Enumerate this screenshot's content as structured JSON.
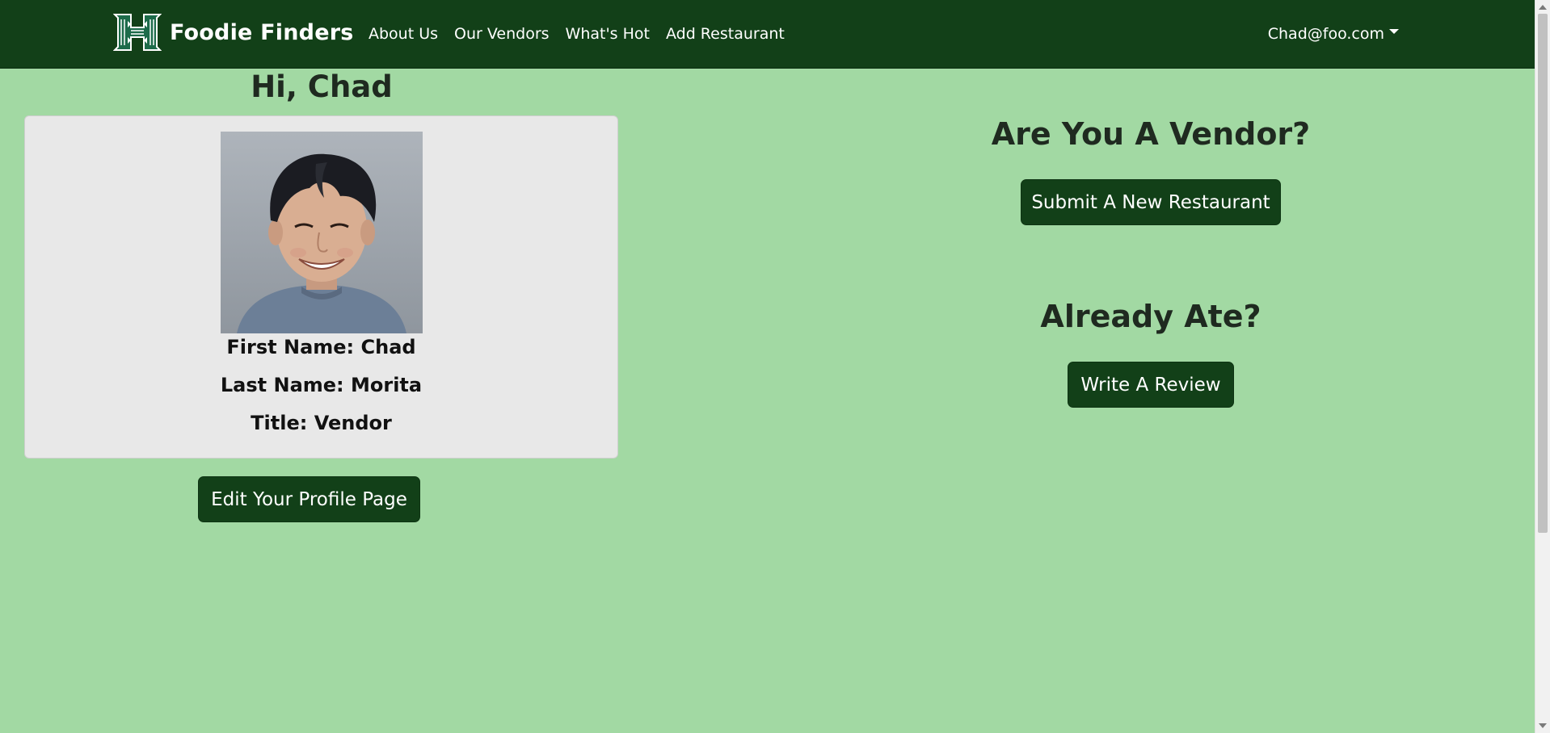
{
  "navbar": {
    "brand_name": "Foodie Finders",
    "logo_icon": "hawaii-h-logo-icon",
    "links": [
      {
        "label": "About Us"
      },
      {
        "label": "Our Vendors"
      },
      {
        "label": "What's Hot"
      },
      {
        "label": "Add Restaurant"
      }
    ],
    "user_email": "Chad@foo.com"
  },
  "profile": {
    "greeting": "Hi, Chad",
    "first_name": "First Name: Chad",
    "last_name": "Last Name: Morita",
    "title": "Title: Vendor",
    "edit_button": "Edit Your Profile Page"
  },
  "vendor_section": {
    "heading": "Are You A Vendor?",
    "button": "Submit A New Restaurant"
  },
  "review_section": {
    "heading": "Already Ate?",
    "button": "Write A Review"
  },
  "colors": {
    "background": "#a2d9a3",
    "navbar": "#124018",
    "button": "#124018",
    "card": "#e8e8e8"
  }
}
